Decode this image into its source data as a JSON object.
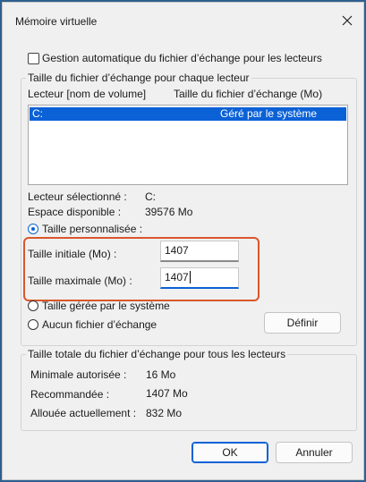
{
  "window": {
    "title": "Mémoire virtuelle"
  },
  "auto_manage": {
    "label": "Gestion automatique du fichier d’échange pour les lecteurs",
    "checked": false
  },
  "per_drive_group": {
    "title": "Taille du fichier d’échange pour chaque lecteur",
    "columns": [
      "Lecteur [nom de volume]",
      "Taille du fichier d’échange (Mo)"
    ],
    "rows": [
      {
        "drive": "C:",
        "size": "Géré par le système",
        "selected": true
      }
    ],
    "selected_drive_label": "Lecteur sélectionné :",
    "selected_drive_value": "C:",
    "free_space_label": "Espace disponible :",
    "free_space_value": "39576 Mo",
    "custom_size_label": "Taille personnalisée :",
    "initial_size_label": "Taille initiale (Mo) :",
    "initial_size_value": "1407",
    "max_size_label": "Taille maximale (Mo) :",
    "max_size_value": "1407",
    "system_managed_label": "Taille gérée par le système",
    "no_paging_label": "Aucun fichier d’échange",
    "set_button": "Définir",
    "selected_option": "custom"
  },
  "total_group": {
    "title": "Taille totale du fichier d’échange pour tous les lecteurs",
    "min_label": "Minimale autorisée :",
    "min_value": "16 Mo",
    "recommended_label": "Recommandée :",
    "recommended_value": "1407 Mo",
    "allocated_label": "Allouée actuellement :",
    "allocated_value": "832 Mo"
  },
  "buttons": {
    "ok": "OK",
    "cancel": "Annuler"
  },
  "colors": {
    "accent": "#0b61d6",
    "highlight_frame": "#d9572b"
  }
}
